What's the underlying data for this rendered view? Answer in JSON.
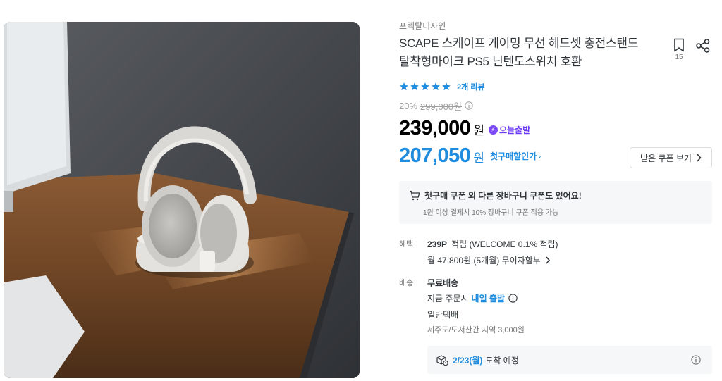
{
  "product": {
    "brand": "프렉탈디자인",
    "title_line1": "SCAPE 스케이프 게이밍 무선 헤드셋 충전스탠드",
    "title_line2": "탈착형마이크 PS5 닌텐도스위치 호환",
    "bookmark_count": "15",
    "review_count_text": "2개 리뷰",
    "stars": 5
  },
  "price": {
    "discount_rate": "20%",
    "original_price": "299,000원",
    "sale_price": "239,000",
    "won": "원",
    "today_ship_badge": "오늘출발",
    "coupon_price": "207,050",
    "coupon_won": "원",
    "first_purchase_link": "첫구매할인가",
    "coupon_button": "받은 쿠폰 보기"
  },
  "cart_notice": {
    "title": "첫구매 쿠폰 외 다른 장바구니 쿠폰도 있어요!",
    "subtitle": "1원 이상 결제시 10% 장바구니 쿠폰 적용 가능"
  },
  "benefit": {
    "label": "혜택",
    "points": "239P",
    "points_suffix": "적립 (WELCOME 0.1% 적립)",
    "installment": "월 47,800원 (5개월) 무이자할부"
  },
  "shipping": {
    "label": "배송",
    "fee": "무료배송",
    "order_now": "지금 주문시",
    "ship_tomorrow": "내일 출발",
    "type": "일반택배",
    "extra": "제주도/도서산간 지역 3,000원"
  },
  "arrival": {
    "date": "2/23(월)",
    "text": "도착 예정"
  },
  "colors": {
    "accent_blue": "#1f8cde",
    "badge_purple": "#7b48f7",
    "text_main": "#2f3438",
    "text_sub": "#757575"
  }
}
